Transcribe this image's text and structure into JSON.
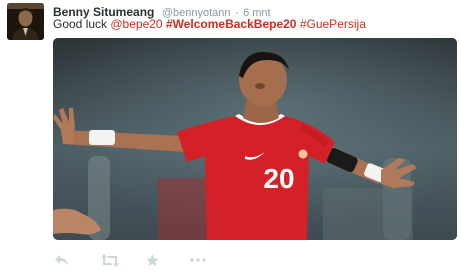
{
  "tweet": {
    "author_name": "Benny Situmeang",
    "handle": "@bennyotann",
    "separator": "·",
    "time": "6 mnt",
    "text": {
      "prefix": "Good luck ",
      "mention": "@bepe20",
      "hashtag_1": "#WelcomeBackBepe20",
      "hashtag_2": "#GuePersija"
    },
    "media": {
      "jersey_number": "20"
    }
  },
  "actions": {
    "reply_icon": "reply-icon",
    "retweet_icon": "retweet-icon",
    "favorite_icon": "star-icon",
    "more_icon": "more-icon"
  },
  "colors": {
    "accent": "#d52b1e",
    "name": "#292f33",
    "muted": "#8899a6",
    "action_icon": "#ccd6dd"
  }
}
